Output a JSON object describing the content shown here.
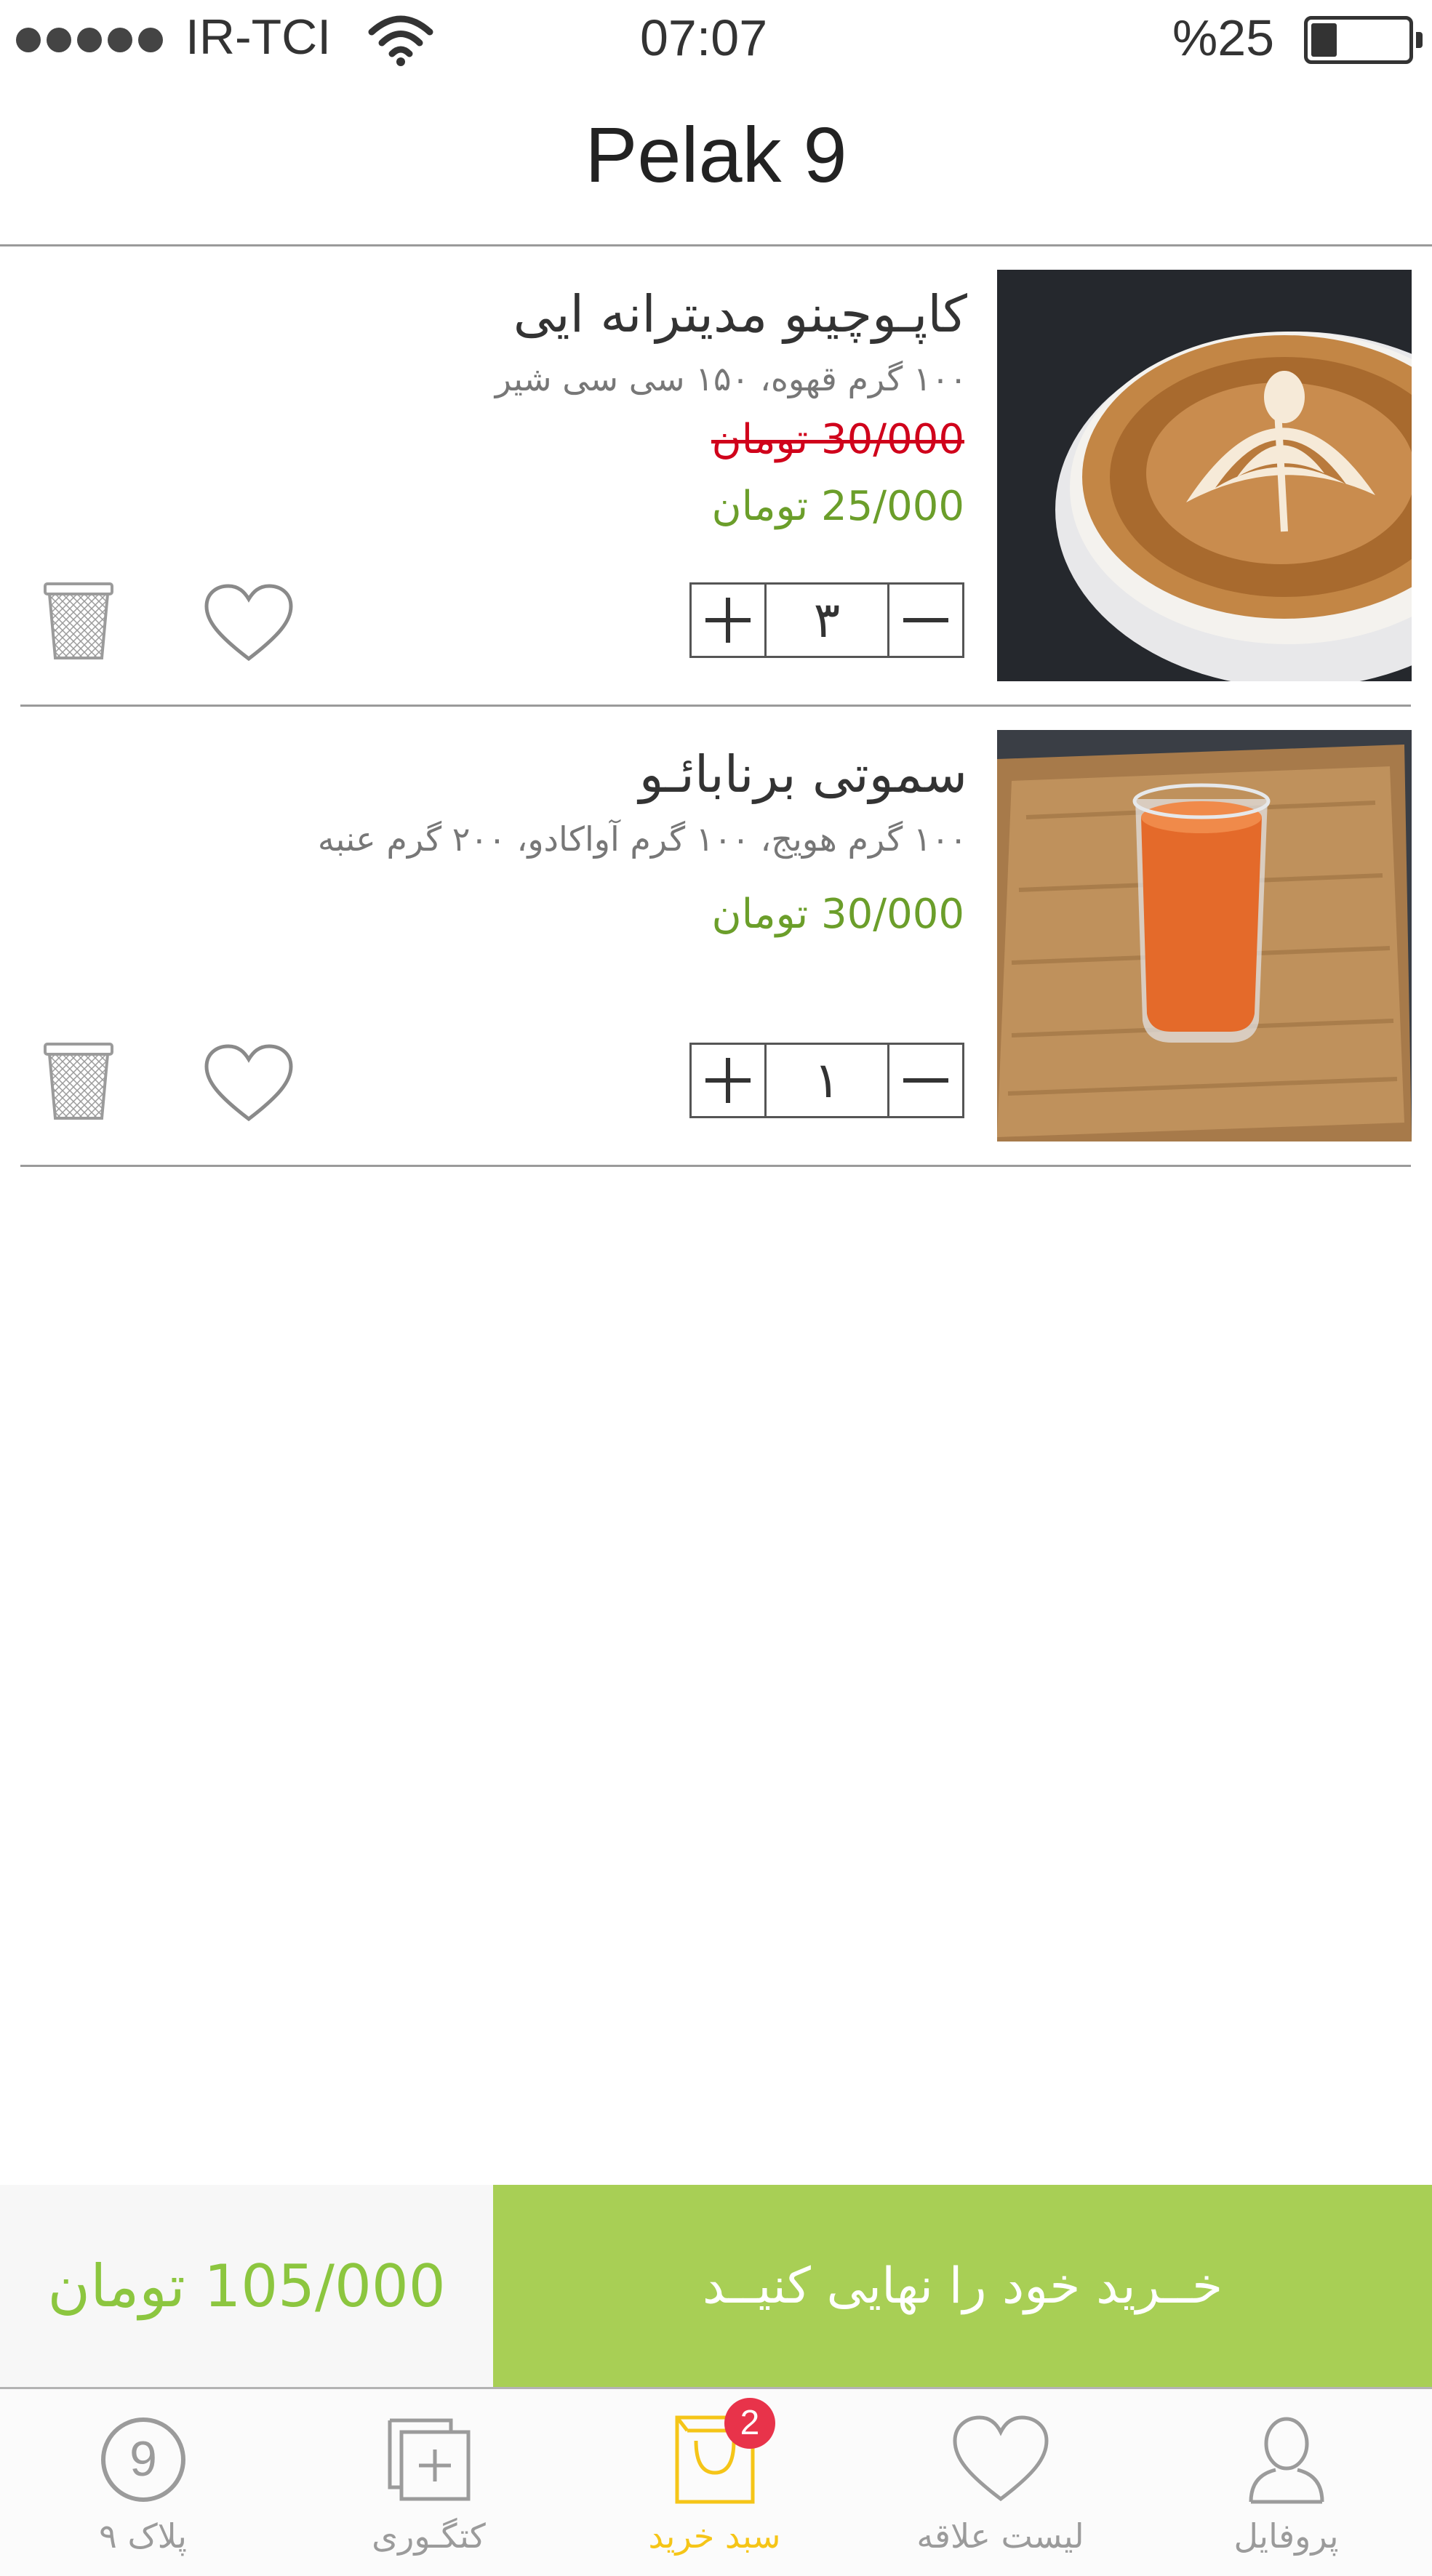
{
  "status_bar": {
    "carrier": "IR-TCI",
    "time": "07:07",
    "battery": "%25"
  },
  "header": {
    "title": "Pelak 9"
  },
  "cart": {
    "items": [
      {
        "name": "کاپـوچینو مدیترانه ایی",
        "description": "۱۰۰ گرم قهوه، ۱۵۰ سی سی شیر",
        "old_price": "30/000 تومان",
        "price": "25/000 تومان",
        "quantity": "۳",
        "image": "cappuccino-photo"
      },
      {
        "name": "سموتی برنابائـو",
        "description": "۱۰۰ گرم هویج، ۱۰۰ گرم آواکادو، ۲۰۰ گرم عنبه",
        "price": "30/000 تومان",
        "quantity": "۱",
        "image": "carrot-smoothie-photo"
      }
    ]
  },
  "checkout": {
    "total": "105/000 تومان",
    "button_label": "خــرید خود را نهایی کنیــد"
  },
  "tab_bar": {
    "tabs": [
      {
        "label": "پلاک ۹",
        "icon": "pelak-9-circle-icon",
        "glyph": "9"
      },
      {
        "label": "کتگـوری",
        "icon": "category-icon"
      },
      {
        "label": "سبد خرید",
        "icon": "shopping-bag-icon",
        "active": true,
        "badge": "2"
      },
      {
        "label": "لیست علاقه",
        "icon": "heart-icon"
      },
      {
        "label": "پروفایل",
        "icon": "profile-icon"
      }
    ]
  },
  "colors": {
    "accent_green": "#a8cf55",
    "price_green": "#6b9e2a",
    "old_price_red": "#d0021b",
    "active_tab_yellow": "#f5c518",
    "badge_red": "#e8334a"
  }
}
